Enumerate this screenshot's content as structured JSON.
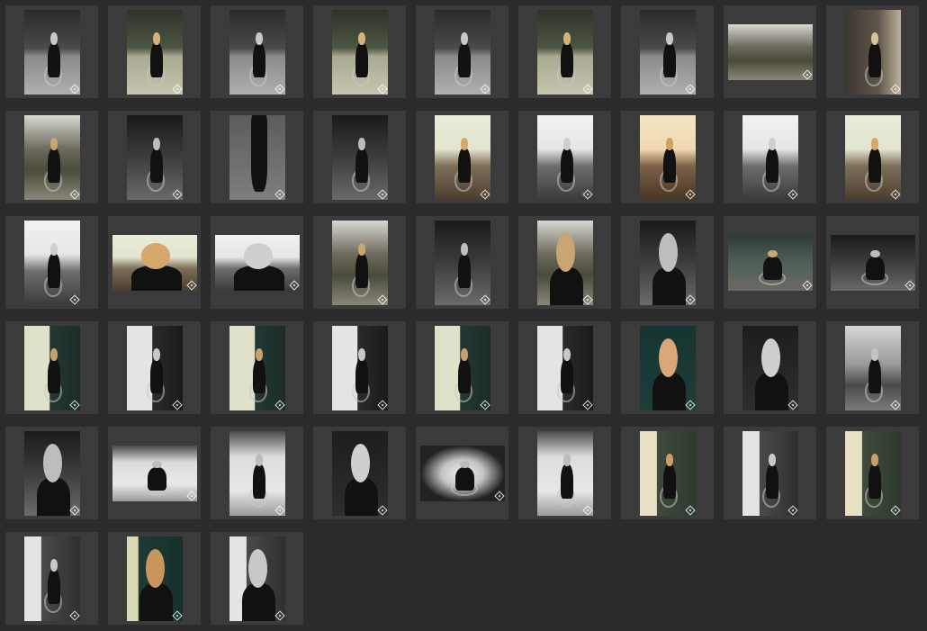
{
  "gallery": {
    "thumbnails": [
      {
        "tone": "forest-bw",
        "aspect": "portrait",
        "subject": "wheelchair"
      },
      {
        "tone": "forest-color",
        "aspect": "portrait",
        "subject": "wheelchair"
      },
      {
        "tone": "forest-bw",
        "aspect": "portrait",
        "subject": "wheelchair"
      },
      {
        "tone": "forest-color",
        "aspect": "portrait",
        "subject": "wheelchair"
      },
      {
        "tone": "forest-bw",
        "aspect": "portrait",
        "subject": "wheelchair"
      },
      {
        "tone": "forest-color",
        "aspect": "portrait",
        "subject": "wheelchair"
      },
      {
        "tone": "forest-bw",
        "aspect": "portrait",
        "subject": "wheelchair"
      },
      {
        "tone": "park-color",
        "aspect": "landscape",
        "subject": "scene"
      },
      {
        "tone": "city-color",
        "aspect": "portrait",
        "subject": "wheelchair"
      },
      {
        "tone": "park-color",
        "aspect": "portrait",
        "subject": "wheelchair"
      },
      {
        "tone": "dark-bw",
        "aspect": "portrait",
        "subject": "wheelchair"
      },
      {
        "tone": "grey-bw",
        "aspect": "portrait",
        "subject": "legs"
      },
      {
        "tone": "dark-bw",
        "aspect": "portrait",
        "subject": "wheelchair"
      },
      {
        "tone": "pier-warm",
        "aspect": "portrait",
        "subject": "wheelchair"
      },
      {
        "tone": "pier-bw",
        "aspect": "portrait",
        "subject": "wheelchair"
      },
      {
        "tone": "pier-orange",
        "aspect": "portrait",
        "subject": "wheelchair"
      },
      {
        "tone": "pier-bw",
        "aspect": "portrait",
        "subject": "wheelchair"
      },
      {
        "tone": "pier-warm",
        "aspect": "portrait",
        "subject": "wheelchair"
      },
      {
        "tone": "pier-bw",
        "aspect": "portrait",
        "subject": "wheelchair"
      },
      {
        "tone": "pier-warm",
        "aspect": "landscape",
        "subject": "portrait"
      },
      {
        "tone": "pier-bw",
        "aspect": "landscape",
        "subject": "portrait"
      },
      {
        "tone": "park-color",
        "aspect": "portrait",
        "subject": "wheelchair"
      },
      {
        "tone": "dark-bw",
        "aspect": "portrait",
        "subject": "wheelchair"
      },
      {
        "tone": "park-color",
        "aspect": "square",
        "subject": "portrait"
      },
      {
        "tone": "dark-bw",
        "aspect": "square",
        "subject": "portrait"
      },
      {
        "tone": "teal-color",
        "aspect": "landscape",
        "subject": "wheelchair"
      },
      {
        "tone": "dark-bw",
        "aspect": "landscape",
        "subject": "wheelchair"
      },
      {
        "tone": "wall-teal",
        "aspect": "portrait",
        "subject": "wheelchair"
      },
      {
        "tone": "wall-bw",
        "aspect": "portrait",
        "subject": "wheelchair"
      },
      {
        "tone": "wall-teal",
        "aspect": "portrait",
        "subject": "wheelchair"
      },
      {
        "tone": "wall-bw",
        "aspect": "portrait",
        "subject": "wheelchair"
      },
      {
        "tone": "wall-teal",
        "aspect": "portrait",
        "subject": "wheelchair"
      },
      {
        "tone": "wall-bw",
        "aspect": "portrait",
        "subject": "wheelchair"
      },
      {
        "tone": "studio-teal",
        "aspect": "portrait",
        "subject": "portrait"
      },
      {
        "tone": "studio-bw",
        "aspect": "portrait",
        "subject": "portrait"
      },
      {
        "tone": "building-bw",
        "aspect": "portrait",
        "subject": "wheelchair"
      },
      {
        "tone": "dark-bw",
        "aspect": "portrait",
        "subject": "portrait"
      },
      {
        "tone": "walkway-bw",
        "aspect": "landscape",
        "subject": "wheelchair"
      },
      {
        "tone": "walkway-bw",
        "aspect": "portrait",
        "subject": "wheelchair"
      },
      {
        "tone": "studio-bw",
        "aspect": "portrait",
        "subject": "portrait"
      },
      {
        "tone": "corridor-bw",
        "aspect": "landscape",
        "subject": "wheelchair"
      },
      {
        "tone": "walkway-bw",
        "aspect": "portrait",
        "subject": "wheelchair"
      },
      {
        "tone": "column-warm",
        "aspect": "portrait",
        "subject": "wheelchair"
      },
      {
        "tone": "column-bw",
        "aspect": "portrait",
        "subject": "wheelchair"
      },
      {
        "tone": "column-warm",
        "aspect": "portrait",
        "subject": "wheelchair"
      },
      {
        "tone": "column-bw",
        "aspect": "portrait",
        "subject": "wheelchair"
      },
      {
        "tone": "column-teal",
        "aspect": "portrait",
        "subject": "portrait"
      },
      {
        "tone": "column-bw",
        "aspect": "portrait",
        "subject": "portrait"
      }
    ]
  },
  "tones": {
    "forest-bw": {
      "bg": "linear-gradient(180deg,#2a2a2a 0%,#4a4a4a 45%,#8a8a8a 55%,#b0b0b0 100%)",
      "head": "#c8c8c8"
    },
    "forest-color": {
      "bg": "linear-gradient(180deg,#2c3328 0%,#4d5643 45%,#a9aa92 55%,#c6c4ad 100%)",
      "head": "#d7b27c"
    },
    "park-color": {
      "bg": "linear-gradient(180deg,#d8d8d2 0%,#6d6a5c 40%,#4a4b3a 65%,#8a877a 100%)",
      "head": "#caa574"
    },
    "city-color": {
      "bg": "linear-gradient(90deg,#3a3630 0%,#5f574a 60%,#bdb29a 100%)",
      "head": "#d8c39a"
    },
    "dark-bw": {
      "bg": "linear-gradient(180deg,#1a1a1a 0%,#3d3d3d 50%,#6a6a6a 100%)",
      "head": "#bdbdbd"
    },
    "grey-bw": {
      "bg": "linear-gradient(180deg,#5c5c5c 0%,#7e7e7e 100%)",
      "head": "#9a9a9a"
    },
    "pier-warm": {
      "bg": "linear-gradient(180deg,#e9ecd8 0%,#e2e4cf 40%,#7e6f58 60%,#4a3d2e 100%)",
      "head": "#d4a86a"
    },
    "pier-bw": {
      "bg": "linear-gradient(180deg,#f2f2f2 0%,#e6e6e6 40%,#6e6e6e 60%,#3a3a3a 100%)",
      "head": "#cfcfcf"
    },
    "pier-orange": {
      "bg": "linear-gradient(180deg,#f5e4c3 0%,#efd8b0 40%,#7b6247 60%,#4a3524 100%)",
      "head": "#d2a063"
    },
    "teal-color": {
      "bg": "linear-gradient(180deg,#2e3a36 0%,#4c5e56 45%,#6a6a62 100%)",
      "head": "#c9a57a"
    },
    "wall-teal": {
      "bg": "linear-gradient(90deg,#dfe1c9 0%,#dfe1c9 45%,#233834 46%,#1c2b28 100%)",
      "head": "#c7a071"
    },
    "wall-bw": {
      "bg": "linear-gradient(90deg,#e4e4e4 0%,#e4e4e4 45%,#2a2a2a 46%,#1a1a1a 100%)",
      "head": "#c8c8c8"
    },
    "studio-teal": {
      "bg": "linear-gradient(180deg,#163430 0%,#1e3d38 100%)",
      "head": "#d9a677"
    },
    "studio-bw": {
      "bg": "linear-gradient(180deg,#1d1d1d 0%,#2e2e2e 100%)",
      "head": "#cfcfcf"
    },
    "building-bw": {
      "bg": "linear-gradient(180deg,#d6d6d6 0%,#9a9a9a 45%,#4a4a4a 70%,#7a7a7a 100%)",
      "head": "#c3c3c3"
    },
    "walkway-bw": {
      "bg": "linear-gradient(180deg,#4a4a4a 0%,#dcdcdc 30%,#e8e8e8 70%,#9a9a9a 100%)",
      "head": "#bdbdbd"
    },
    "corridor-bw": {
      "bg": "radial-gradient(ellipse at center,#f0f0f0 0%,#c4c4c4 35%,#222222 70%)",
      "head": "#bbbbbb"
    },
    "column-warm": {
      "bg": "linear-gradient(90deg,#e6e1c3 0%,#e6e1c3 30%,#3f4a3a 31%,#2c3a2e 100%)",
      "head": "#c9a06c"
    },
    "column-bw": {
      "bg": "linear-gradient(90deg,#e4e4e4 0%,#e4e4e4 30%,#4a4a4a 31%,#2f2f2f 100%)",
      "head": "#c8c8c8"
    },
    "column-teal": {
      "bg": "linear-gradient(90deg,#dad9b6 0%,#dad9b6 20%,#1f3a35 21%,#17302b 100%)",
      "head": "#c9955f"
    }
  }
}
